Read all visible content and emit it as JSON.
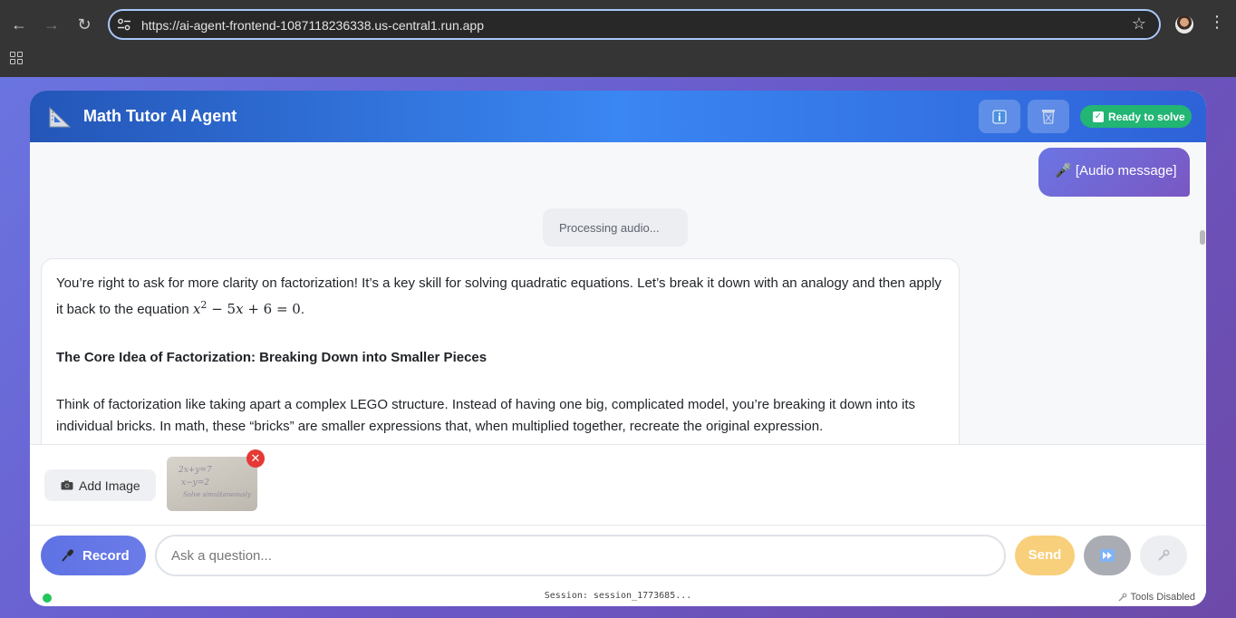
{
  "browser": {
    "url": "https://ai-agent-frontend-1087118236338.us-central1.run.app"
  },
  "header": {
    "title": "Math Tutor AI Agent",
    "status": "Ready to solve"
  },
  "chat": {
    "user_message": "🎤 [Audio message]",
    "processing": "Processing audio...",
    "bot": {
      "intro_a": "You’re right to ask for more clarity on factorization! It’s a key skill for solving quadratic equations. Let’s break it down with an analogy and then apply it back to the equation ",
      "equation": "x² − 5x + 6 = 0",
      "intro_end": ".",
      "heading": "The Core Idea of Factorization: Breaking Down into Smaller Pieces",
      "para": "Think of factorization like taking apart a complex LEGO structure. Instead of having one big, complicated model, you’re breaking it down into its individual bricks. In math, these “bricks” are smaller expressions that, when multiplied together, recreate the original expression."
    }
  },
  "attachments": {
    "add_image_label": "Add Image"
  },
  "input": {
    "record_label": "Record",
    "placeholder": "Ask a question...",
    "send_label": "Send"
  },
  "footer": {
    "session": "Session: session_1773685...",
    "tools_status": "Tools Disabled"
  },
  "colors": {
    "header_accent": "#3a86f2",
    "status_green": "#22b573",
    "send_button": "#f8cf7a",
    "record_button": "#5f72e4"
  }
}
